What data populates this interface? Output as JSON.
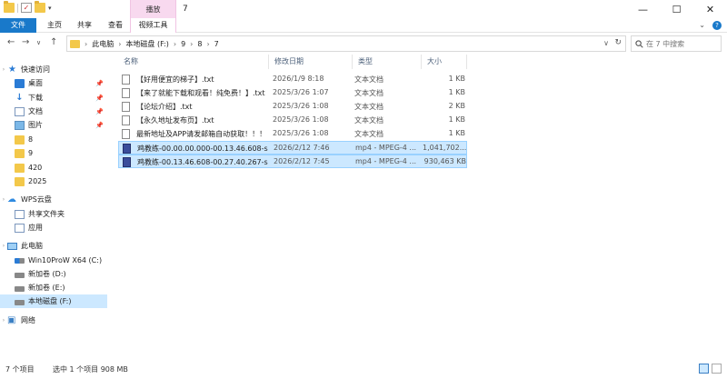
{
  "titlebar": {
    "context_tab": "播放",
    "window_title": "7",
    "quick_access_arrow": "▾",
    "controls": {
      "minimize": "—",
      "maximize": "☐",
      "close": "✕"
    }
  },
  "ribbon": {
    "tabs": [
      "文件",
      "主页",
      "共享",
      "查看",
      "视频工具"
    ],
    "right_chevron": "⌄",
    "help": "?"
  },
  "address": {
    "crumbs": [
      "此电脑",
      "本地磁盘 (F:)",
      "9",
      "8",
      "7"
    ],
    "search_placeholder": "在 7 中搜索"
  },
  "sidebar": {
    "items": [
      {
        "label": "快速访问"
      },
      {
        "label": "桌面"
      },
      {
        "label": "下载"
      },
      {
        "label": "文档"
      },
      {
        "label": "图片"
      },
      {
        "label": "8"
      },
      {
        "label": "9"
      },
      {
        "label": "420"
      },
      {
        "label": "2025"
      },
      {
        "label": "WPS云盘"
      },
      {
        "label": "共享文件夹"
      },
      {
        "label": "应用"
      },
      {
        "label": "此电脑"
      },
      {
        "label": "Win10ProW X64 (C:)"
      },
      {
        "label": "新加卷 (D:)"
      },
      {
        "label": "新加卷 (E:)"
      },
      {
        "label": "本地磁盘 (F:)"
      },
      {
        "label": "网络"
      }
    ]
  },
  "columns": {
    "name": "名称",
    "date": "修改日期",
    "type": "类型",
    "size": "大小"
  },
  "files": [
    {
      "name": "【好用便宜的梯子】.txt",
      "date": "2026/1/9 8:18",
      "type": "文本文档",
      "size": "1 KB"
    },
    {
      "name": "【来了就能下载和观看！纯免费！】.txt",
      "date": "2025/3/26 1:07",
      "type": "文本文档",
      "size": "1 KB"
    },
    {
      "name": "【论坛介绍】.txt",
      "date": "2025/3/26 1:08",
      "type": "文本文档",
      "size": "2 KB"
    },
    {
      "name": "【永久地址发布页】.txt",
      "date": "2025/3/26 1:08",
      "type": "文本文档",
      "size": "1 KB"
    },
    {
      "name": "最新地址及APP请发邮箱自动获取！！！...",
      "date": "2025/3/26 1:08",
      "type": "文本文档",
      "size": "1 KB"
    },
    {
      "name": "鸡教练-00.00.00.000-00.13.46.608-seg...",
      "date": "2026/2/12 7:46",
      "type": "mp4 - MPEG-4 ...",
      "size": "1,041,702..."
    },
    {
      "name": "鸡教练-00.13.46.608-00.27.40.267-seg...",
      "date": "2026/2/12 7:45",
      "type": "mp4 - MPEG-4 ...",
      "size": "930,463 KB"
    }
  ],
  "status": {
    "count": "7 个项目",
    "selected": "选中 1 个项目  908 MB"
  }
}
